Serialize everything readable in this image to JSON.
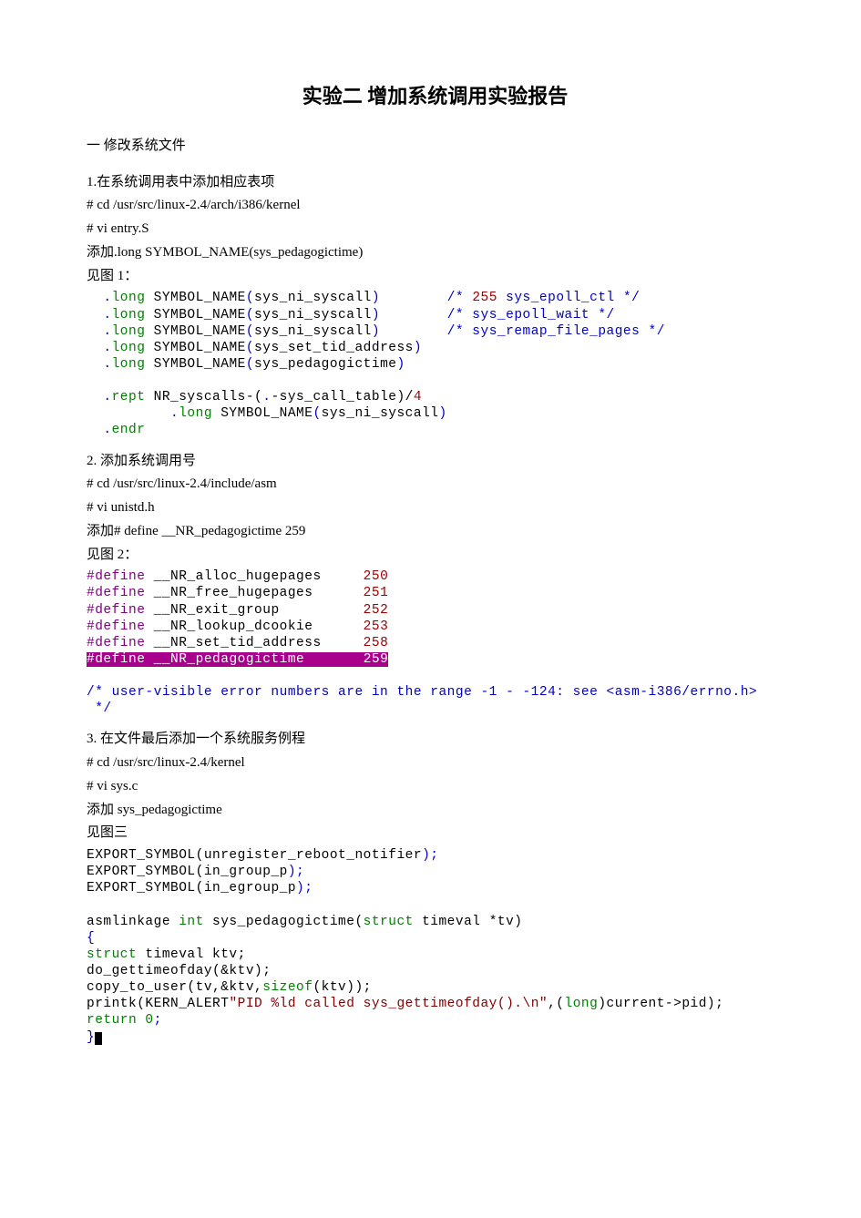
{
  "title": "实验二  增加系统调用实验报告",
  "h1": "一  修改系统文件",
  "s1": {
    "heading": "1.在系统调用表中添加相应表项",
    "cmd1": "#  cd  /usr/src/linux-2.4/arch/i386/kernel",
    "cmd2": "#  vi  entry.S",
    "add_prefix": "添加",
    "add_body": ".long  SYMBOL_NAME(sys_pedagogictime)",
    "see": "见图 1："
  },
  "code1": {
    "dot": ".",
    "kw": "long",
    "sym": "SYMBOL_NAME",
    "lp": "(",
    "rp": ")",
    "a1": "sys_ni_syscall",
    "a4": "sys_set_tid_address",
    "a5": "sys_pedagogictime",
    "c1a": "/* ",
    "c1b": "255",
    "c1c": " sys_epoll_ctl */",
    "c2": "/* sys_epoll_wait */",
    "c3": "/* sys_remap_file_pages */",
    "rept": "rept",
    "rept_expr_a": " NR_syscalls-(",
    "rept_expr_b": "-sys_call_table)/",
    "four": "4",
    "endr": "endr"
  },
  "s2": {
    "heading": "2.  添加系统调用号",
    "cmd1": "#  cd  /usr/src/linux-2.4/include/asm",
    "cmd2": "#  vi  unistd.h",
    "add_prefix": "添加",
    "add_body": "#  define      __NR_pedagogictime        259",
    "see": "见图 2："
  },
  "code2": {
    "def": "#define ",
    "n1": "__NR_alloc_hugepages",
    "v1": "250",
    "n2": "__NR_free_hugepages",
    "v2": "251",
    "n3": "__NR_exit_group",
    "v3": "252",
    "n4": "__NR_lookup_dcookie",
    "v4": "253",
    "n5": "__NR_set_tid_address",
    "v5": "258",
    "n6": "__NR_pedagogictime",
    "v6": "259",
    "comment": "/* user-visible error numbers are in the range -1 - -124: see <asm-i386/errno.h>\n */"
  },
  "s3": {
    "heading": "3.  在文件最后添加一个系统服务例程",
    "cmd1": "#  cd  /usr/src/linux-2.4/kernel",
    "cmd2": "#  vi  sys.c",
    "add_prefix": "添加",
    "add_body": " sys_pedagogictime",
    "see": "见图三"
  },
  "code3": {
    "exp": "EXPORT_SYMBOL(",
    "e1": "unregister_reboot_notifier",
    "e2": "in_group_p",
    "e3": "in_egroup_p",
    "rp_semi": ");",
    "asml": "asmlinkage ",
    "int": "int",
    "fn": " sys_pedagogictime(",
    "struct": "struct",
    "sig": " timeval *tv)",
    "lb": "{",
    "decl": " timeval ktv;",
    "dogt": "do_gettimeofday(&ktv);",
    "copy_a": "copy_to_user(tv,&ktv,",
    "sizeof": "sizeof",
    "copy_b": "(ktv));",
    "prk_a": "printk(KERN_ALERT",
    "prk_str": "\"PID %ld called sys_gettimeofday().\\n\"",
    "prk_b": ",(",
    "long": "long",
    "prk_c": ")current->pid);",
    "ret": "return 0",
    "semi": ";",
    "rb": "}"
  }
}
